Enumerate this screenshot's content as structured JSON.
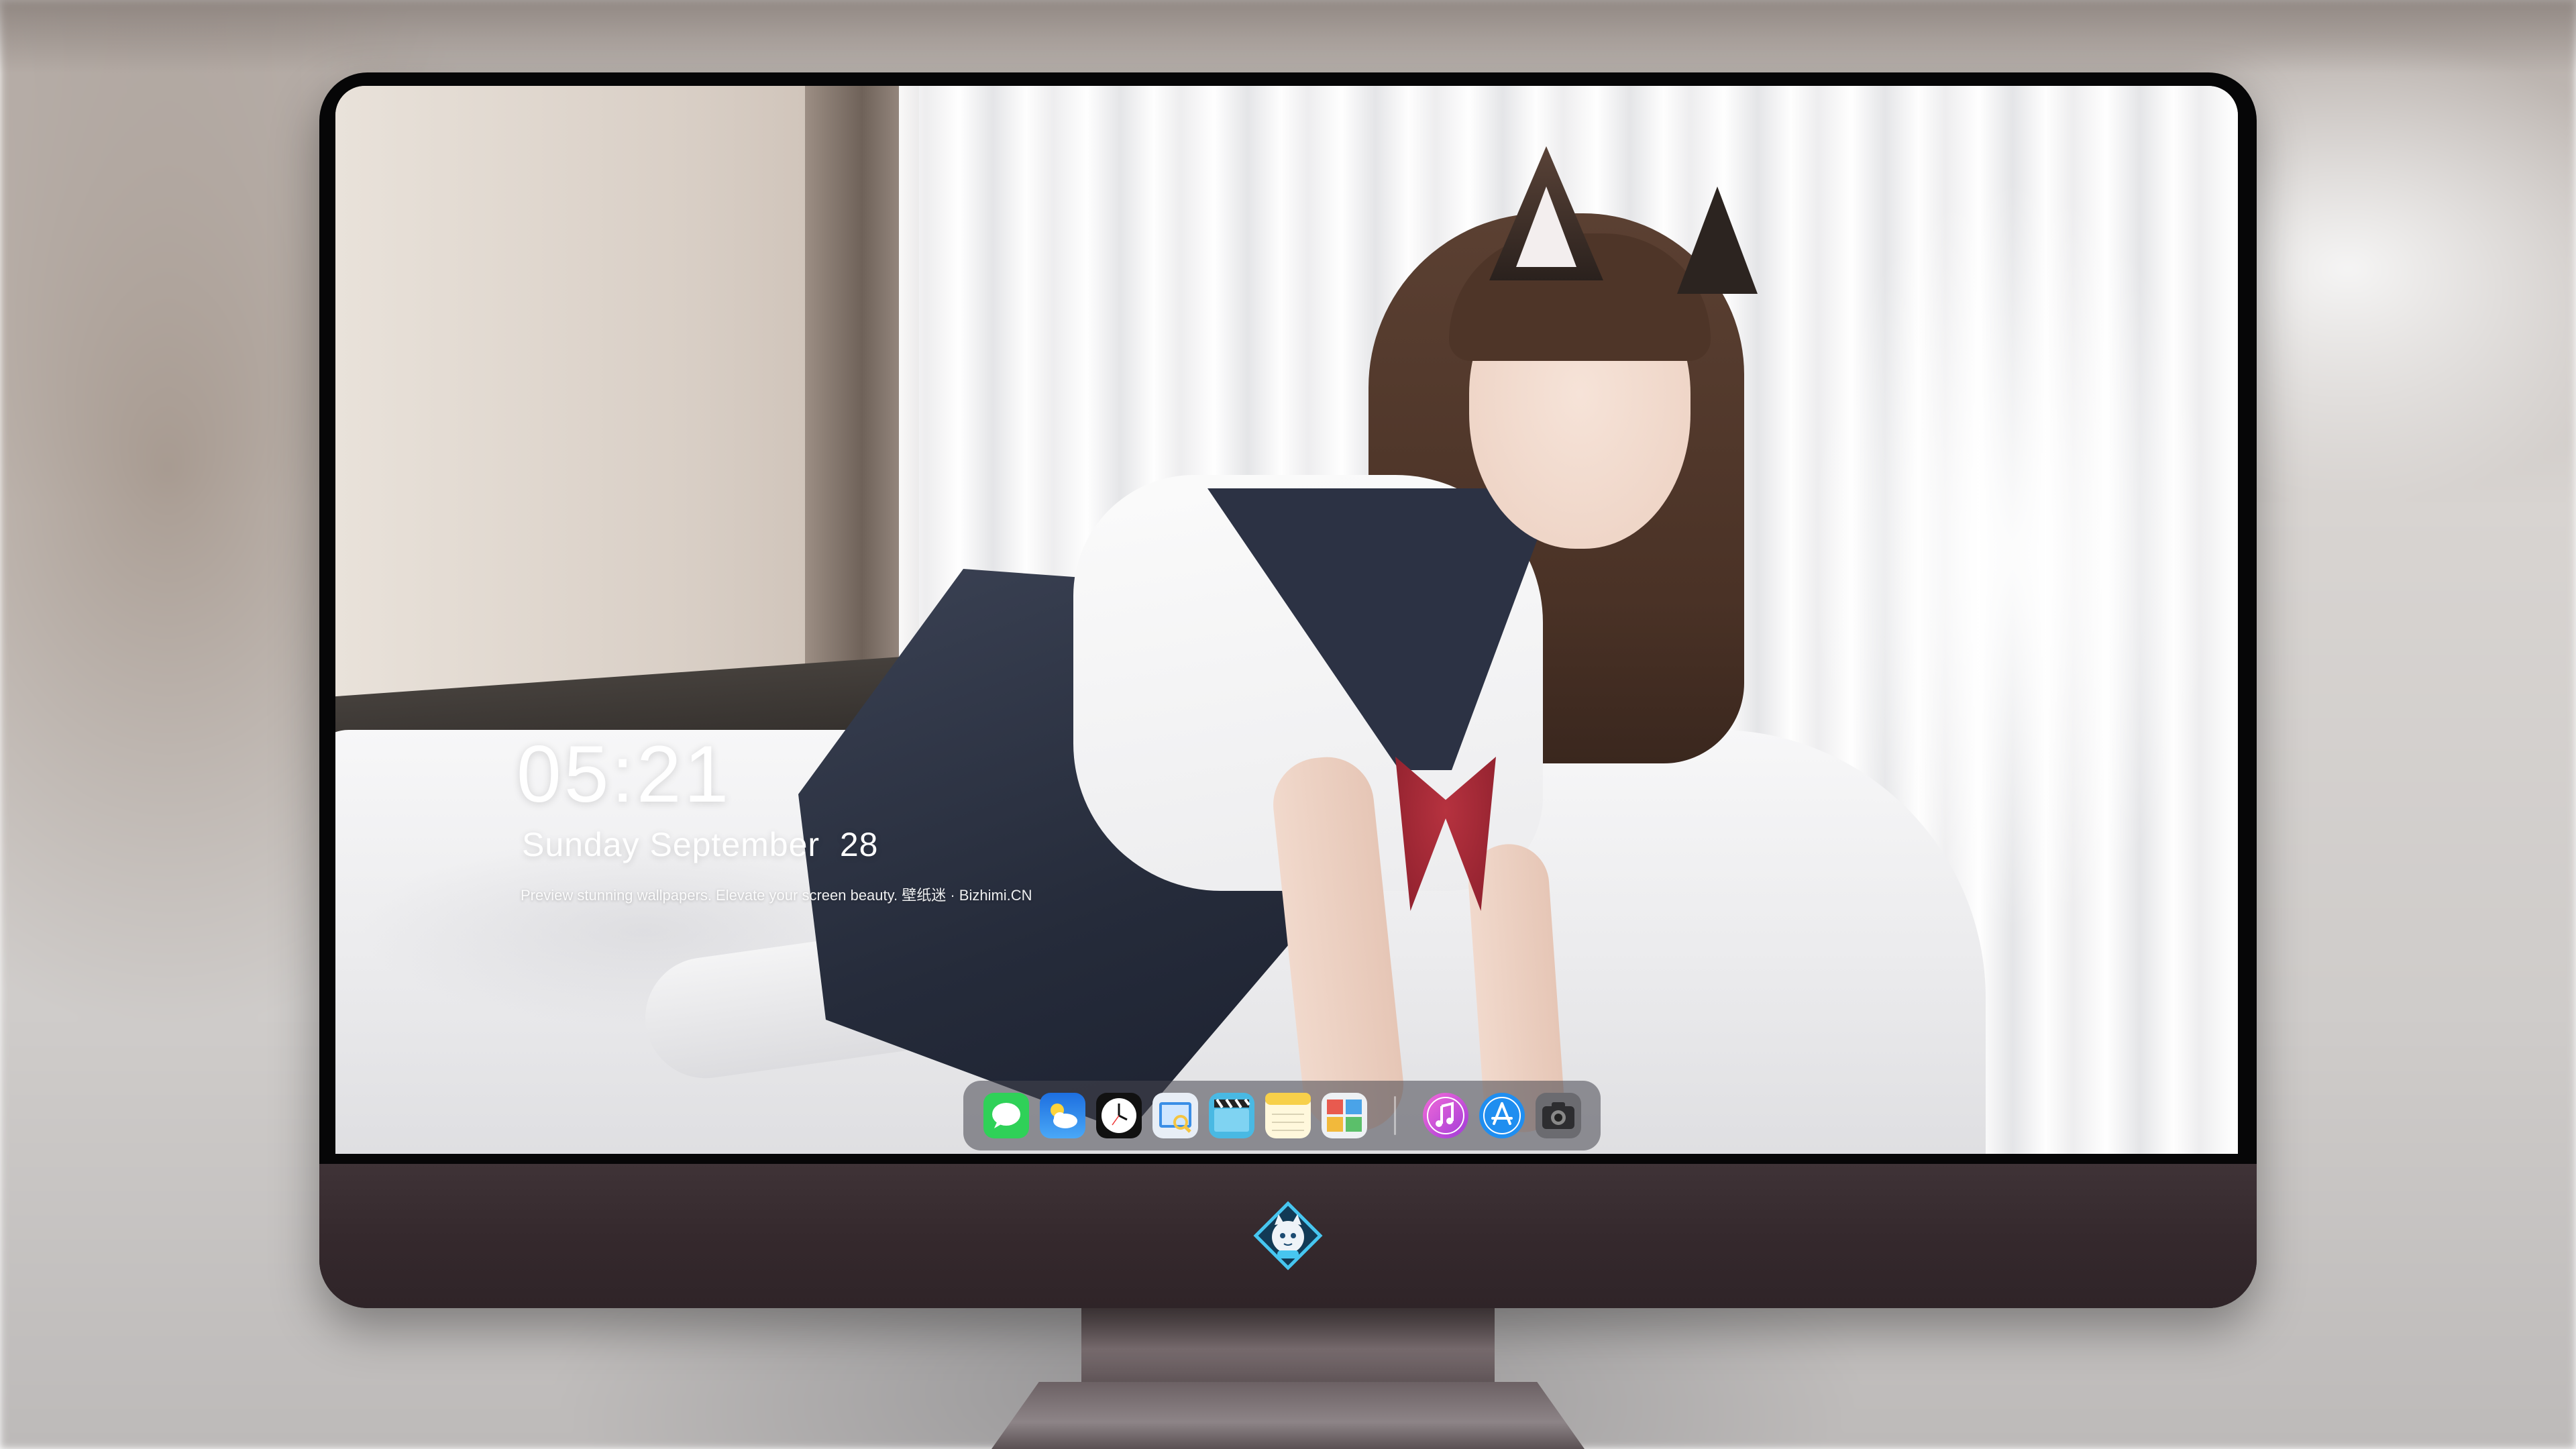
{
  "lockscreen": {
    "time": "05:21",
    "date": "Sunday September  28",
    "tagline": "Preview stunning wallpapers. Elevate your screen beauty. 壁纸迷 · Bizhimi.CN"
  },
  "dock": {
    "apps": [
      {
        "icon": "messages-icon",
        "color": "#2fd158"
      },
      {
        "icon": "weather-icon",
        "color": "#2a8cf2"
      },
      {
        "icon": "clock-icon",
        "color": "#111111"
      },
      {
        "icon": "preview-icon",
        "color": "#f4c542"
      },
      {
        "icon": "video-clapper-icon",
        "color": "#49b9e3"
      },
      {
        "icon": "notes-icon",
        "color": "#f7d04a"
      },
      {
        "icon": "photo-gallery-icon",
        "color": "#e85a4f"
      },
      {
        "icon": "music-icon",
        "color": "#d04bd6"
      },
      {
        "icon": "app-store-icon",
        "color": "#1f8ef0"
      },
      {
        "icon": "camera-icon",
        "color": "#555559"
      }
    ]
  },
  "monitor": {
    "chin_logo": "bizhimi-mascot-logo-icon"
  }
}
